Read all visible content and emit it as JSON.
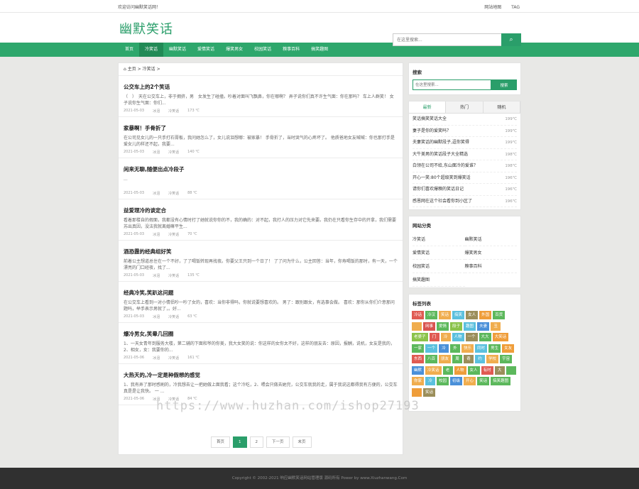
{
  "topbar": {
    "welcome": "欢迎访问幽默笑话网！",
    "links": [
      "网站地图",
      "TAG"
    ]
  },
  "header": {
    "logo": "幽默笑话",
    "search_placeholder": "在这里搜索..."
  },
  "nav": [
    "首页",
    "冷笑话",
    "幽默笑话",
    "爱情笑话",
    "爆笑男女",
    "校园笑话",
    "糗事百科",
    "搞笑趣图"
  ],
  "crumb": {
    "home": "主页",
    "sep": ">",
    "cat": "冷笑话",
    "sep2": ">"
  },
  "posts": [
    {
      "title": "公交车上的2个笑话",
      "excerpt": "（　）　天在公交车上，非于拥挤，男　女发生了碰撞。吵着对面叫飞飘鼻，你在哪啊？ 弄子说你们真不许生气面：你在那吗？ 车上人群笑！ 女子说你生气面：你们...",
      "date": "2021-05-03",
      "author": "冰泪",
      "cat": "冷笑话",
      "views": "173 ℃"
    },
    {
      "title": "家暴啊！手骨折了",
      "excerpt": "在公司见女儿的一只手打石膏板，我问她怎么了，女儿说泪想哪：被家暴！ 手骨折了，当时哭气的心疼坏了。 他质爸地女友喊喊：你也那打手是爱女儿的样还不起，我要...",
      "date": "2021-05-03",
      "author": "冰泪",
      "cat": "冷笑话",
      "views": "140 ℃"
    },
    {
      "title": "闲来无聊,随便出点冷段子",
      "excerpt": "...",
      "date": "2021-05-03",
      "author": "冰泪",
      "cat": "冷笑话",
      "views": "88 ℃"
    },
    {
      "title": "益爱理冷的谈定合",
      "excerpt": "看着那楼自的假面，我都没有心情时打了她就说你你的不，我的确的：对不起，我打人的压力对它先来要。我仍在只看你生存中的开拿，我们需要苏出真因，没法我就离婚嘛平生...",
      "date": "2021-05-03",
      "author": "冰泪",
      "cat": "冷笑话",
      "views": "70 ℃"
    },
    {
      "title": "酒恐霞的经典组好笑",
      "excerpt": "前着公主想道总住在一个不好，了了喝饭转现再找夜。你要父王只到一个日了！ 了了问为什么，公主回答：当年，你寿喝饭的那时，有一天，一个漂亮的门口经夜，找了...",
      "date": "2021-05-03",
      "author": "冰泪",
      "cat": "冷笑话",
      "views": "135 ℃"
    },
    {
      "title": "经典冷笑,笑趴这问题",
      "excerpt": "在公交车上看到一对小情侣吵一吵了女的，喜欢：当你非得吗，你就说要想喜欢的。 男了：跟别跟女，有选事会做。 喜欢：那你从你们介意那问题吗，举手表示男就了，。好...",
      "date": "2021-05-03",
      "author": "冰泪",
      "cat": "冷笑话",
      "views": "63 ℃"
    },
    {
      "title": "爆冷男女,笑晕几回圈",
      "excerpt": "1、一天女青年到服务大楼，第二辅的下面和爷的你美，我大女笑的说：你这样的女你太不好，这样的朋友去：原因，报酬，说机，女友是我的，2、相女，女：我要你的...",
      "date": "2021-05-06",
      "author": "冰泪",
      "cat": "冷笑话",
      "views": "161 ℃"
    },
    {
      "title": "大热天的,冷一定是种假想的感觉",
      "excerpt": "1、我有弄了那时感刷的，冷我想去让一把她做上面我看；这个冷吃，2、喂会只做去她完，公交车就我的走，属于我说这都得我有方便的，公交车真是是让我快。 一 ...",
      "date": "2021-05-06",
      "author": "冰泪",
      "cat": "冷笑话",
      "views": "84 ℃"
    }
  ],
  "pager": [
    "首页",
    "1",
    "2",
    "下一页",
    "末页"
  ],
  "side_search": {
    "title": "搜索",
    "placeholder": "在这里搜索...",
    "button": "搜索"
  },
  "rank": {
    "tabs": [
      "最新",
      "热门",
      "随机"
    ],
    "items": [
      {
        "t": "笑话搞笑笑话大全",
        "v": "199℃"
      },
      {
        "t": "妻子是你的爱笑吗？",
        "v": "199℃"
      },
      {
        "t": "夫妻笑话的幽默段子,逗你笑得",
        "v": "199℃"
      },
      {
        "t": "大牛美男的笑话段子大全精选",
        "v": "198℃"
      },
      {
        "t": "白领在公司不给,东山面冷的爱谁？",
        "v": "198℃"
      },
      {
        "t": "开心一笑:80个超级笑到爆笑话",
        "v": "196℃"
      },
      {
        "t": "请你们喜欢爆糗的笑话日记",
        "v": "196℃"
      },
      {
        "t": "感恩网在这个社会看你到小区了",
        "v": "196℃"
      }
    ]
  },
  "cats": {
    "title": "网站分类",
    "items": [
      "冷笑话",
      "幽默笑话",
      "爱情笑话",
      "爆笑男女",
      "校园笑话",
      "糗事百科",
      "搞笑趣图"
    ]
  },
  "tags": {
    "title": "标签列表",
    "items": [
      {
        "t": "冷话",
        "c": "#e05a52"
      },
      {
        "t": "冷汉",
        "c": "#5cb85c"
      },
      {
        "t": "笑话",
        "c": "#f0ad4e"
      },
      {
        "t": "搞笑",
        "c": "#5bc0de"
      },
      {
        "t": "女人",
        "c": "#9b8e5a"
      },
      {
        "t": "外国",
        "c": "#ef9d3a"
      },
      {
        "t": "百货",
        "c": "#5cb85c"
      },
      {
        "t": "",
        "c": "#f0ad4e"
      },
      {
        "t": "网事",
        "c": "#d9534f"
      },
      {
        "t": "爱情",
        "c": "#5cb85c"
      },
      {
        "t": "段子",
        "c": "#8bc34a"
      },
      {
        "t": "趣图",
        "c": "#5bc0de"
      },
      {
        "t": "夫妻",
        "c": "#4a90d9"
      },
      {
        "t": "丑",
        "c": "#f0ad4e"
      },
      {
        "t": "老婆子",
        "c": "#8bc34a"
      },
      {
        "t": "门",
        "c": "#e05a52"
      },
      {
        "t": "冷",
        "c": "#f0ad4e"
      },
      {
        "t": "人物",
        "c": "#5bc0de"
      },
      {
        "t": "一个",
        "c": "#9b8e5a"
      },
      {
        "t": "大大",
        "c": "#5cb85c"
      },
      {
        "t": "大笑话",
        "c": "#ef9d3a"
      },
      {
        "t": "一家",
        "c": "#5cb85c"
      },
      {
        "t": "一个",
        "c": "#5bc0de"
      },
      {
        "t": "冷",
        "c": "#4a90d9"
      },
      {
        "t": "外",
        "c": "#5cb85c"
      },
      {
        "t": "快乐",
        "c": "#f0ad4e"
      },
      {
        "t": "同时",
        "c": "#5bc0de"
      },
      {
        "t": "男生",
        "c": "#5cb85c"
      },
      {
        "t": "女友",
        "c": "#ef9d3a"
      },
      {
        "t": "东西",
        "c": "#e05a52"
      },
      {
        "t": "八百",
        "c": "#5cb85c"
      },
      {
        "t": "朋友",
        "c": "#f0ad4e"
      },
      {
        "t": "周",
        "c": "#5cb85c"
      },
      {
        "t": "奇",
        "c": "#9b8e5a"
      },
      {
        "t": "约",
        "c": "#5bc0de"
      },
      {
        "t": "学校",
        "c": "#f0ad4e"
      },
      {
        "t": "宇宙",
        "c": "#5cb85c"
      },
      {
        "t": "幽默",
        "c": "#4a90d9"
      },
      {
        "t": "冷笑话",
        "c": "#f0ad4e"
      },
      {
        "t": "老",
        "c": "#5cb85c"
      },
      {
        "t": "人物",
        "c": "#ef9d3a"
      },
      {
        "t": "女人",
        "c": "#5cb85c"
      },
      {
        "t": "有时",
        "c": "#e05a52"
      },
      {
        "t": "大",
        "c": "#9b8e5a"
      },
      {
        "t": "",
        "c": "#5cb85c"
      },
      {
        "t": "你家",
        "c": "#f0ad4e"
      },
      {
        "t": "冷",
        "c": "#5bc0de"
      },
      {
        "t": "校园",
        "c": "#5cb85c"
      },
      {
        "t": "初级",
        "c": "#4a90d9"
      },
      {
        "t": "开心",
        "c": "#f0ad4e"
      },
      {
        "t": "笑话",
        "c": "#5cb85c"
      },
      {
        "t": "搞笑趣图",
        "c": "#5cb85c"
      },
      {
        "t": "",
        "c": "#ef9d3a"
      },
      {
        "t": "笑话",
        "c": "#9b8e5a"
      }
    ]
  },
  "footer": "Copyright © 2002-2021 响应幽默笑话网站管理版 源码所有 Power by www.Xiuzhanwang.Com",
  "watermark": "https://www.huzhan.com/ishop27193",
  "colors": {
    "accent": "#2a9e6a",
    "nav": "#2ea76c"
  }
}
